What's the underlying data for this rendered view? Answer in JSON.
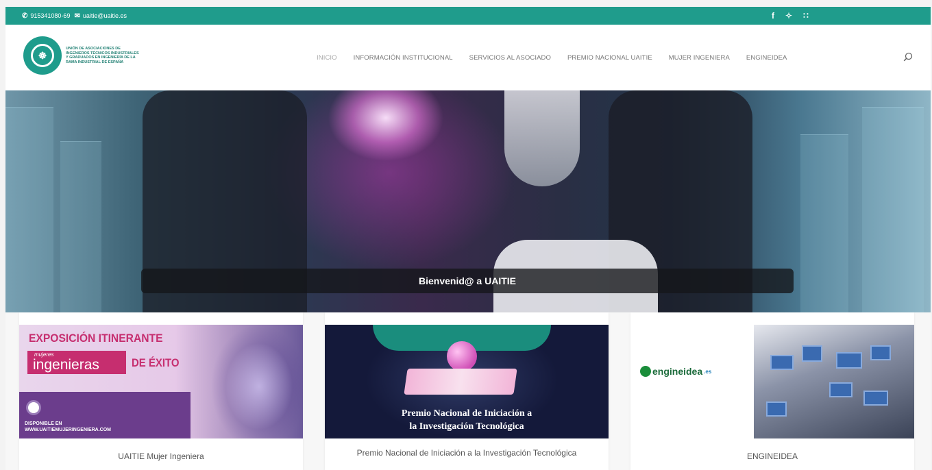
{
  "topbar": {
    "phone": "915341080-69",
    "email": "uaitie@uaitie.es",
    "social": {
      "facebook": "f",
      "twitter": "✧",
      "rss": "∷"
    }
  },
  "logo": {
    "text": "UNIÓN DE ASOCIACIONES DE INGENIEROS TÉCNICOS INDUSTRIALES Y GRADUADOS EN INGENIERÍA DE LA RAMA INDUSTRIAL DE ESPAÑA"
  },
  "nav": {
    "items": [
      {
        "label": "INICIO"
      },
      {
        "label": "INFORMACIÓN INSTITUCIONAL"
      },
      {
        "label": "SERVICIOS AL ASOCIADO"
      },
      {
        "label": "PREMIO NACIONAL UAITIE"
      },
      {
        "label": "MUJER INGENIERA"
      },
      {
        "label": "ENGINEIDEA"
      }
    ]
  },
  "hero": {
    "welcome": "Bienvenid@ a UAITIE"
  },
  "cards": [
    {
      "caption": "UAITIE Mujer Ingeniera",
      "banner": {
        "line1": "EXPOSICIÓN ITINERANTE",
        "small": "mujeres",
        "big": "ingenieras",
        "tail": "DE ÉXITO",
        "available": "DISPONIBLE EN",
        "url": "WWW.UAITIEMUJERINGENIERA.COM"
      }
    },
    {
      "caption": "Premio Nacional de Iniciación a la Investigación Tecnológica",
      "banner": {
        "title1": "Premio Nacional de Iniciación a",
        "title2": "la Investigación Tecnológica"
      }
    },
    {
      "caption": "ENGINEIDEA",
      "banner": {
        "brand": "engineidea",
        "tld": ".es"
      }
    }
  ]
}
